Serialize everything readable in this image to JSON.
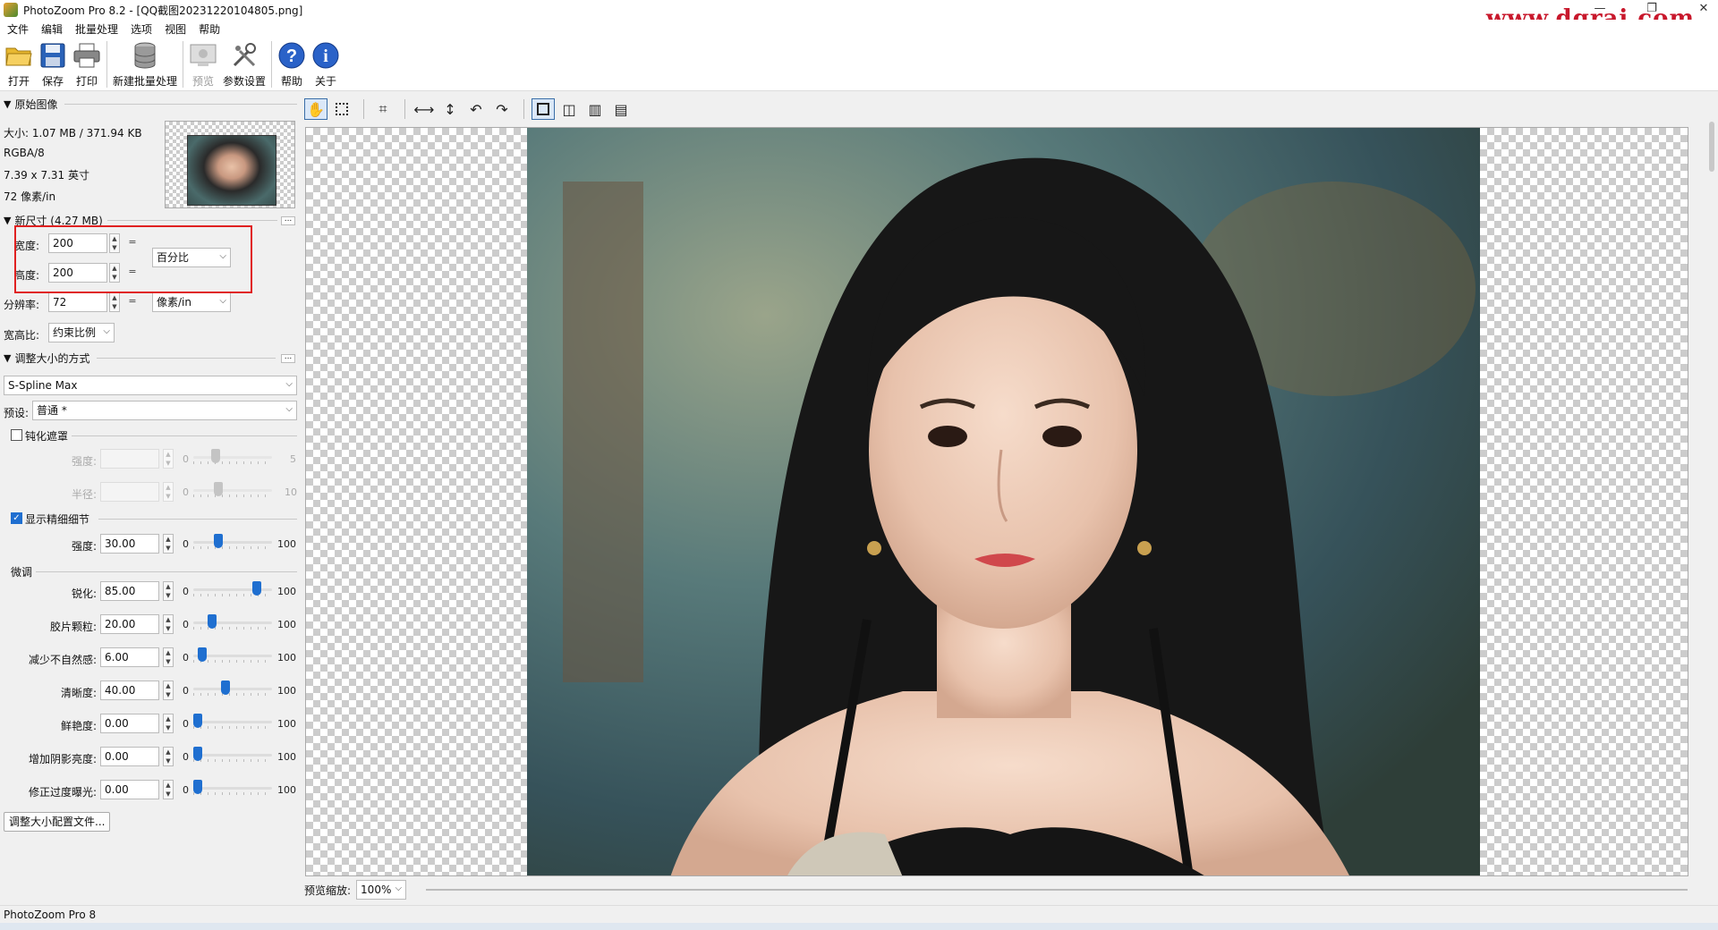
{
  "window": {
    "title": "PhotoZoom Pro 8.2 - [QQ截图20231220104805.png]",
    "watermark": "www.dgrai.com",
    "controls": [
      "—",
      "❐",
      "✕"
    ]
  },
  "menu": [
    "文件",
    "编辑",
    "批量处理",
    "选项",
    "视图",
    "帮助"
  ],
  "toolbar": {
    "open": "打开",
    "save": "保存",
    "print": "打印",
    "new_batch": "新建批量处理",
    "preview": "预览",
    "settings": "参数设置",
    "help": "帮助",
    "about": "关于"
  },
  "original": {
    "header": "原始图像",
    "size": "大小: 1.07 MB / 371.94 KB",
    "mode": "RGBA/8",
    "dimensions": "7.39 x 7.31 英寸",
    "resolution": "72 像素/in"
  },
  "new_size": {
    "header": "新尺寸 (4.27 MB)",
    "width_label": "宽度:",
    "width_value": "200",
    "height_label": "高度:",
    "height_value": "200",
    "unit": "百分比",
    "resolution_label": "分辨率:",
    "resolution_value": "72",
    "resolution_unit": "像素/in",
    "aspect_label": "宽高比:",
    "aspect_value": "约束比例"
  },
  "method": {
    "header": "调整大小的方式",
    "algorithm": "S-Spline Max",
    "preset_label": "预设:",
    "preset_value": "普通 *"
  },
  "unsharp": {
    "label": "钝化遮罩",
    "checked": false,
    "strength_label": "强度:",
    "strength_min": "0",
    "strength_max": "5",
    "strength_level": 0.25,
    "radius_label": "半径:",
    "radius_min": "0",
    "radius_max": "10",
    "radius_level": 0.3
  },
  "details": {
    "label": "显示精细细节",
    "checked": true,
    "strength_label": "强度:",
    "strength_value": "30.00",
    "min": "0",
    "max": "100",
    "level": 0.3
  },
  "finetune": {
    "header": "微调",
    "rows": [
      {
        "label": "锐化:",
        "value": "85.00",
        "min": "0",
        "max": "100",
        "level": 0.85
      },
      {
        "label": "胶片颗粒:",
        "value": "20.00",
        "min": "0",
        "max": "100",
        "level": 0.2
      },
      {
        "label": "减少不自然感:",
        "value": "6.00",
        "min": "0",
        "max": "100",
        "level": 0.06
      },
      {
        "label": "清晰度:",
        "value": "40.00",
        "min": "0",
        "max": "100",
        "level": 0.4
      },
      {
        "label": "鲜艳度:",
        "value": "0.00",
        "min": "0",
        "max": "100",
        "level": 0.0
      },
      {
        "label": "增加阴影亮度:",
        "value": "0.00",
        "min": "0",
        "max": "100",
        "level": 0.0
      },
      {
        "label": "修正过度曝光:",
        "value": "0.00",
        "min": "0",
        "max": "100",
        "level": 0.0
      }
    ],
    "profile_button": "调整大小配置文件..."
  },
  "preview": {
    "zoom_label": "预览缩放:",
    "zoom_value": "100%"
  },
  "status": {
    "text": "PhotoZoom Pro 8"
  },
  "colors": {
    "accent": "#1f6fd0",
    "highlight_box": "#e02020",
    "watermark": "#c8182c"
  }
}
